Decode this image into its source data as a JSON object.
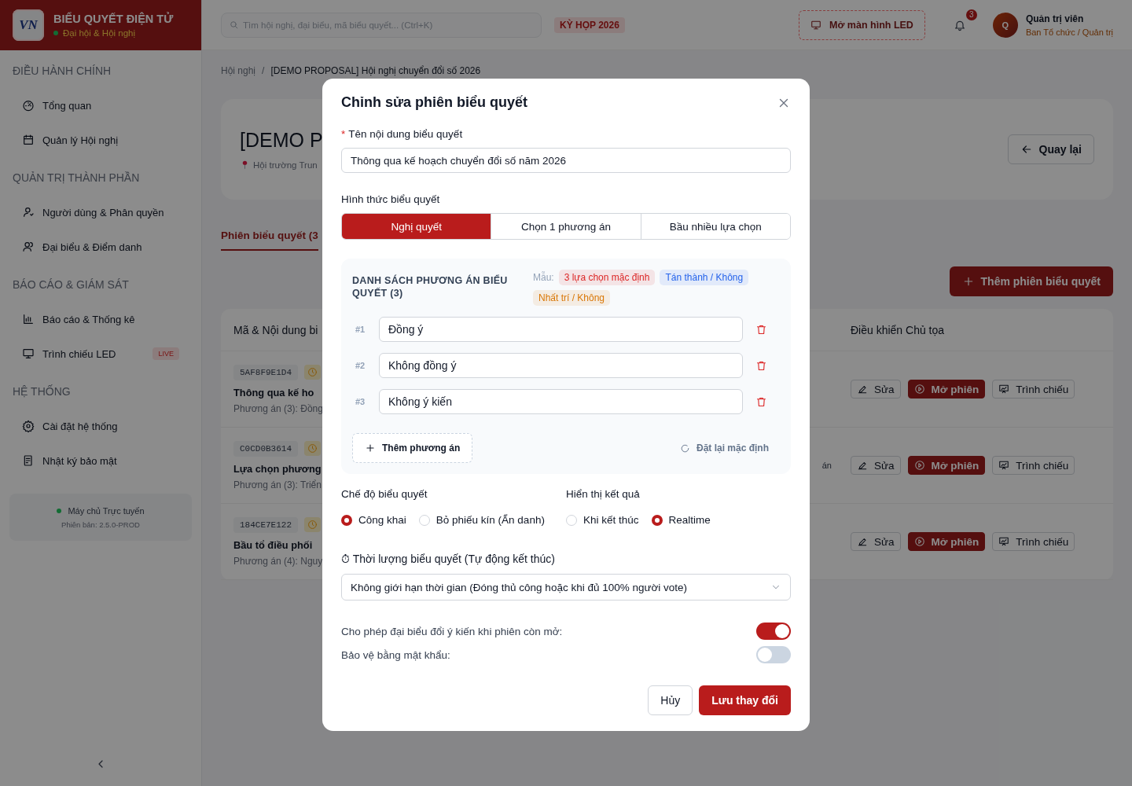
{
  "sidebar": {
    "brand": {
      "logo_text": "VN",
      "title": "BIỂU QUYẾT ĐIỆN TỬ",
      "subtitle": "Đại hội & Hội nghị"
    },
    "sections": [
      {
        "heading": "ĐIỀU HÀNH CHÍNH",
        "items": [
          {
            "label": "Tổng quan"
          },
          {
            "label": "Quản lý Hội nghị"
          }
        ]
      },
      {
        "heading": "QUẢN TRỊ THÀNH PHẦN",
        "items": [
          {
            "label": "Người dùng & Phân quyền"
          },
          {
            "label": "Đại biểu & Điểm danh"
          }
        ]
      },
      {
        "heading": "BÁO CÁO & GIÁM SÁT",
        "items": [
          {
            "label": "Báo cáo & Thống kê"
          },
          {
            "label": "Trình chiếu LED",
            "badge": "LIVE"
          }
        ]
      },
      {
        "heading": "HỆ THỐNG",
        "items": [
          {
            "label": "Cài đặt hệ thống"
          },
          {
            "label": "Nhật ký bảo mật"
          }
        ]
      }
    ],
    "status": {
      "label": "Máy chủ Trực tuyến",
      "version": "Phiên bản: 2.5.0-PROD"
    }
  },
  "topbar": {
    "search": {
      "placeholder": "Tìm hội nghị, đại biểu, mã biểu quyết... (Ctrl+K)"
    },
    "session_tag": "KỲ HỌP 2026",
    "led_button": "Mở màn hình LED",
    "notifications": "3",
    "user": {
      "avatar": "Q",
      "name": "Quản trị viên",
      "role": "Ban Tổ chức / Quản trị"
    }
  },
  "main": {
    "breadcrumb": [
      "Hội nghị",
      "[DEMO PROPOSAL] Hội nghị chuyển đổi số 2026"
    ],
    "breadcrumb_separator": "/",
    "header": {
      "title": "[DEMO P",
      "location": "Hội trường Trun",
      "back_button": "Quay lại"
    },
    "tabs": [
      {
        "label": "Phiên biểu quyết (3",
        "selected": true
      }
    ],
    "add_button": "Thêm phiên biểu quyết",
    "table": {
      "columns": [
        "Mã & Nội dung bi",
        "Điều khiển Chủ tọa"
      ],
      "rows": [
        {
          "code": "5AF8F9E1D4",
          "title": "Thông qua kế ho",
          "summary": "Phương án (3): Đồng",
          "actions": [
            "Sửa",
            "Mở phiên",
            "Trình chiếu"
          ]
        },
        {
          "code": "C0CD0B3614",
          "title": "Lựa chọn phương",
          "summary": "Phương án (3): Triển",
          "fragment": "án",
          "actions": [
            "Sửa",
            "Mở phiên",
            "Trình chiếu"
          ]
        },
        {
          "code": "184CE7E122",
          "title": "Bầu tổ điều phối",
          "summary": "Phương án (4): Nguy",
          "actions": [
            "Sửa",
            "Mở phiên",
            "Trình chiếu"
          ]
        }
      ]
    }
  },
  "modal": {
    "title": "Chỉnh sửa phiên biểu quyết",
    "name_field": {
      "label": "Tên nội dung biểu quyết",
      "required_mark": "*",
      "value": "Thông qua kế hoạch chuyển đổi số năm 2026"
    },
    "type_field": {
      "label": "Hình thức biểu quyết",
      "options": [
        {
          "label": "Nghị quyết",
          "selected": true
        },
        {
          "label": "Chọn 1 phương án",
          "selected": false
        },
        {
          "label": "Bầu nhiều lựa chọn",
          "selected": false
        }
      ]
    },
    "options_panel": {
      "heading": "DANH SÁCH PHƯƠNG ÁN BIỂU QUYẾT (3)",
      "template_label": "Mẫu:",
      "templates": [
        {
          "label": "3 lựa chọn mặc định",
          "color": "#dc2626"
        },
        {
          "label": "Tán thành / Không",
          "color": "#2563eb"
        },
        {
          "label": "Nhất trí / Không",
          "color": "#d97706"
        }
      ],
      "options": [
        {
          "index": "#1",
          "value": "Đồng ý"
        },
        {
          "index": "#2",
          "value": "Không đồng ý"
        },
        {
          "index": "#3",
          "value": "Không ý kiến"
        }
      ],
      "add_button": "Thêm phương án",
      "reset_button": "Đặt lại mặc định"
    },
    "radio_groups": [
      {
        "label": "Chế độ biểu quyết",
        "choices": [
          {
            "label": "Công khai",
            "selected": true
          },
          {
            "label": "Bỏ phiếu kín (Ẩn danh)",
            "selected": false
          }
        ]
      },
      {
        "label": "Hiển thị kết quả",
        "choices": [
          {
            "label": "Khi kết thúc",
            "selected": false
          },
          {
            "label": "Realtime",
            "selected": true
          }
        ]
      }
    ],
    "duration": {
      "label": "⏱ Thời lượng biểu quyết (Tự động kết thúc)",
      "value": "Không giới hạn thời gian (Đóng thủ công hoặc khi đủ 100% người vote)"
    },
    "toggles": [
      {
        "label": "Cho phép đại biểu đổi ý kiến khi phiên còn mở:",
        "on": true
      },
      {
        "label": "Bảo vệ bằng mật khẩu:",
        "on": false
      }
    ],
    "buttons": {
      "cancel": "Hủy",
      "save": "Lưu thay đổi"
    }
  }
}
